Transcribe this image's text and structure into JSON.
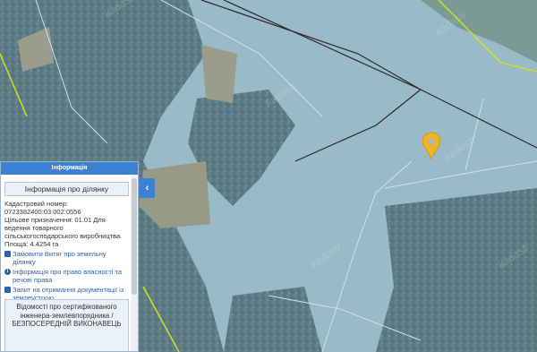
{
  "map": {
    "watermark_text": "kadastr",
    "colors": {
      "parcel_tint": "#8fb6d8",
      "parcel_border": "#cfe0f0",
      "road": "#2a2a2a",
      "boundary_green": "#d4e020",
      "marker": "#f0b429"
    }
  },
  "panel": {
    "header_title": "Інформація",
    "section_title": "Інформація про ділянку",
    "cadastral_label": "Кадастровий номер:",
    "cadastral_number": "0723382400:03:002:0556",
    "purpose_line1": "Цільове призначення: 01.01 Для",
    "purpose_line2": "ведення товарного",
    "purpose_line3": "сільськогосподарського виробництва",
    "area": "Площа: 4.4254 га",
    "links": [
      {
        "line1": "Замовити Витяг про земельну",
        "line2": "ділянку"
      },
      {
        "line1": "Інформація про право власності та",
        "line2": "речові права"
      },
      {
        "line1": "Запит на отримання документації із",
        "line2": "землеустрою"
      }
    ],
    "footer_line1": "Відомості про сертифікованого",
    "footer_line2": "інженера-землевпорядника /",
    "footer_line3": "БЕЗПОСЕРЕДНІЙ ВИКОНАВЕЦЬ"
  },
  "controls": {
    "collapse_icon": "chevron-left"
  }
}
